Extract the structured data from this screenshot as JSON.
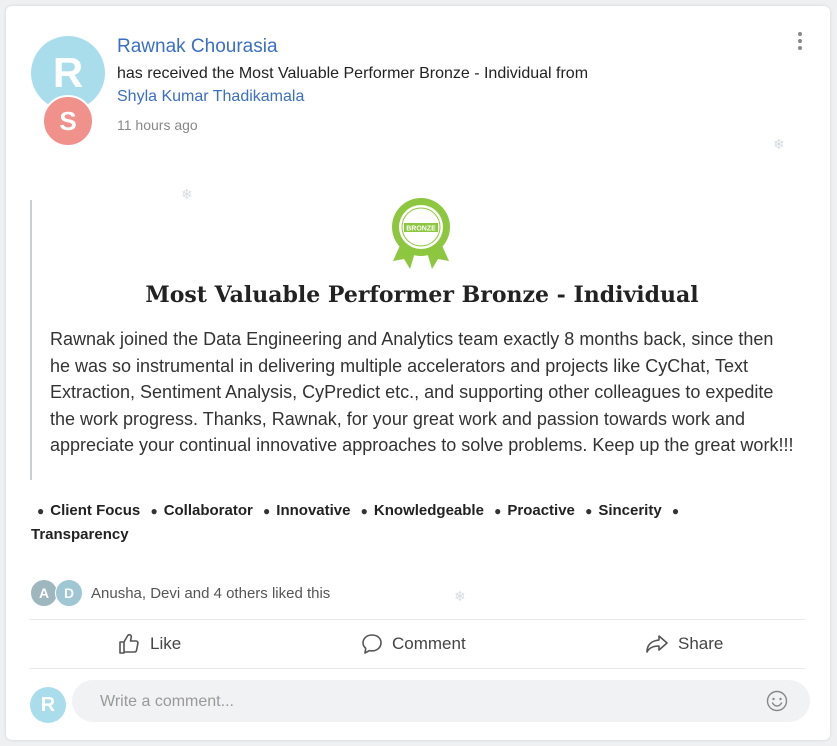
{
  "post": {
    "recipient": "Rawnak Chourasia",
    "received_text": "has received the Most Valuable Performer Bronze - Individual from",
    "giver": "Shyla Kumar Thadikamala",
    "time": "11 hours ago",
    "recipient_initial": "R",
    "giver_initial": "S"
  },
  "award": {
    "badge_text": "BRONZE",
    "title": "Most Valuable Performer Bronze - Individual",
    "description": "Rawnak joined the Data Engineering and Analytics team exactly 8 months back, since then he was so instrumental in delivering multiple accelerators and projects like CyChat, Text Extraction, Sentiment Analysis, CyPredict etc., and supporting other colleagues to expedite the work progress. Thanks, Rawnak, for your great work and passion towards work and appreciate your continual innovative approaches to solve problems. Keep up the great work!!!"
  },
  "tags": [
    "Client Focus",
    "Collaborator",
    "Innovative",
    "Knowledgeable",
    "Proactive",
    "Sincerity",
    "Transparency"
  ],
  "likes": {
    "avatars": [
      "A",
      "D"
    ],
    "text": "Anusha,  Devi and 4 others liked this"
  },
  "actions": {
    "like": "Like",
    "comment": "Comment",
    "share": "Share"
  },
  "comment": {
    "avatar_initial": "R",
    "placeholder": "Write a comment..."
  },
  "colors": {
    "link": "#3a6fc4",
    "avatar_r": "#a9ddec",
    "avatar_s": "#f0928b",
    "badge_green": "#8dc63f"
  },
  "icons": [
    "more-vertical-icon",
    "thumbs-up-icon",
    "comment-bubble-icon",
    "share-arrow-icon",
    "smiley-icon",
    "snowflake-icon",
    "bronze-badge-icon"
  ]
}
